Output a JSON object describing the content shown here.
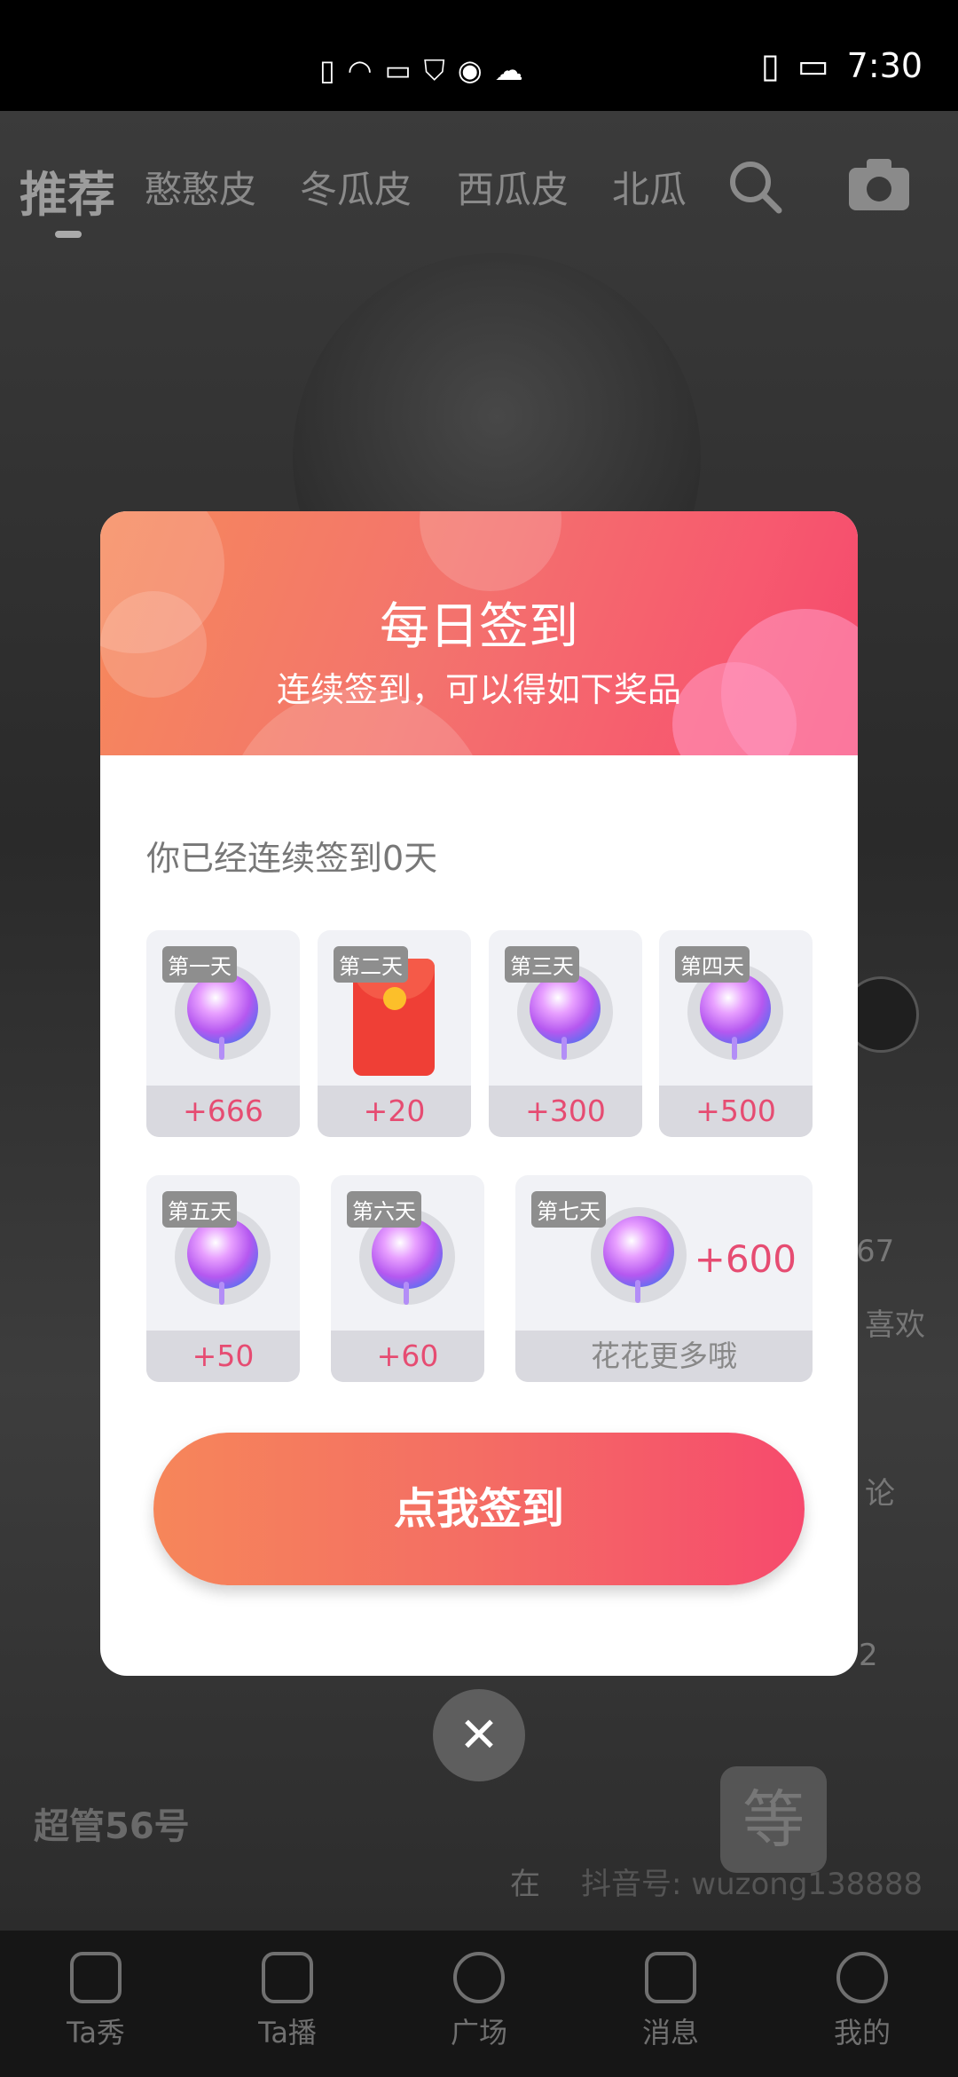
{
  "status_bar": {
    "time": "7:30",
    "left_icons": [
      "sim-alert-icon",
      "wifi-icon",
      "huawei-icon",
      "shield-icon",
      "browser-icon",
      "cloud-icon"
    ],
    "right_icons": [
      "vibrate-icon",
      "battery-charging-icon"
    ]
  },
  "top_nav": {
    "tabs": [
      {
        "label": "推荐",
        "active": true
      },
      {
        "label": "憨憨皮"
      },
      {
        "label": "冬瓜皮"
      },
      {
        "label": "西瓜皮"
      },
      {
        "label": "北瓜"
      }
    ]
  },
  "feed": {
    "username": "超管56号",
    "caption_prefix": "在",
    "douyin_id": "抖音号: wuzong138888",
    "side": {
      "likes_count": "67",
      "like_label": "喜欢",
      "comment_label": "论",
      "share_count": "2"
    },
    "logo_text": "等"
  },
  "dialog": {
    "title": "每日签到",
    "subtitle": "连续签到，可以得如下奖品",
    "streak_text": "你已经连续签到0天",
    "rewards": [
      {
        "day": "第一天",
        "amount": "+666",
        "icon": "rose-icon"
      },
      {
        "day": "第二天",
        "amount": "+20",
        "icon": "red-packet-icon"
      },
      {
        "day": "第三天",
        "amount": "+300",
        "icon": "rose-icon"
      },
      {
        "day": "第四天",
        "amount": "+500",
        "icon": "rose-icon"
      },
      {
        "day": "第五天",
        "amount": "+50",
        "icon": "rose-icon"
      },
      {
        "day": "第六天",
        "amount": "+60",
        "icon": "rose-icon"
      },
      {
        "day": "第七天",
        "amount": "+600",
        "footer": "花花更多哦",
        "icon": "rose-icon"
      }
    ],
    "sign_button": "点我签到",
    "close_icon": "close-icon"
  },
  "bottom_nav": {
    "items": [
      {
        "label": "Ta秀",
        "icon": "heart-icon"
      },
      {
        "label": "Ta播",
        "icon": "live-icon"
      },
      {
        "label": "广场",
        "icon": "plaza-icon"
      },
      {
        "label": "消息",
        "icon": "message-icon"
      },
      {
        "label": "我的",
        "icon": "profile-icon"
      }
    ]
  },
  "colors": {
    "accent": "#f4486c",
    "header_start": "#f6895b",
    "reward_text": "#e64c72"
  }
}
